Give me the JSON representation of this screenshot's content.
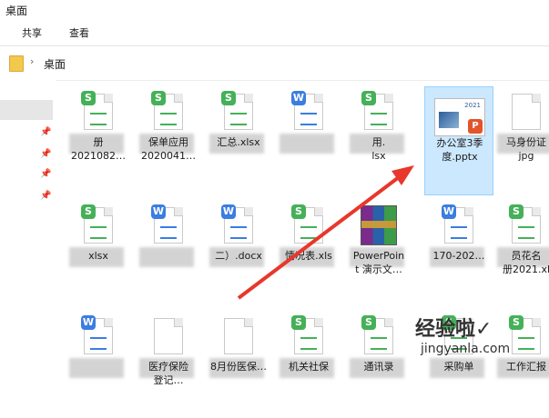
{
  "window": {
    "title": "桌面"
  },
  "ribbon": {
    "tabs": [
      "共享",
      "查看"
    ]
  },
  "address": {
    "separator": "›",
    "crumb": "桌面"
  },
  "nav": {
    "pins": [
      "📌",
      "📌",
      "📌",
      "📌"
    ]
  },
  "items": [
    {
      "type": "S",
      "label": "册\n2021082…"
    },
    {
      "type": "S",
      "label": "保单应用\n2020041…"
    },
    {
      "type": "S",
      "label": "汇总.xlsx"
    },
    {
      "type": "W",
      "label": ""
    },
    {
      "type": "S",
      "label": "用.\nlsx"
    },
    {
      "type": "ppt",
      "label": "办公室3季\n度.pptx",
      "selected": true,
      "thumb_text": "2021"
    },
    {
      "type": "other",
      "label": "马身份证\njpg"
    },
    {
      "type": "S",
      "label": "xlsx"
    },
    {
      "type": "W",
      "label": ""
    },
    {
      "type": "W",
      "label": "二）.docx"
    },
    {
      "type": "S",
      "label": "情况表.xls"
    },
    {
      "type": "rar",
      "label": "PowerPoin\nt 演示文…"
    },
    {
      "type": "W",
      "label": "170-202…"
    },
    {
      "type": "S",
      "label": "员花名\n册2021.xl"
    },
    {
      "type": "W",
      "label": ""
    },
    {
      "type": "other",
      "label": "医疗保险\n登记…"
    },
    {
      "type": "other",
      "label": "8月份医保…"
    },
    {
      "type": "S",
      "label": "机关社保"
    },
    {
      "type": "S",
      "label": "通讯录"
    },
    {
      "type": "S",
      "label": "采购单"
    },
    {
      "type": "S",
      "label": "工作汇报"
    }
  ],
  "badges": {
    "S": "S",
    "W": "W",
    "P": "P"
  },
  "colors": {
    "S": "#45b058",
    "W": "#3b7de0",
    "accent_arrow": "#e8372b",
    "selected_bg": "#cce8ff"
  },
  "watermark": {
    "cn": "经验啦✓",
    "en": "jingyanla.com"
  }
}
